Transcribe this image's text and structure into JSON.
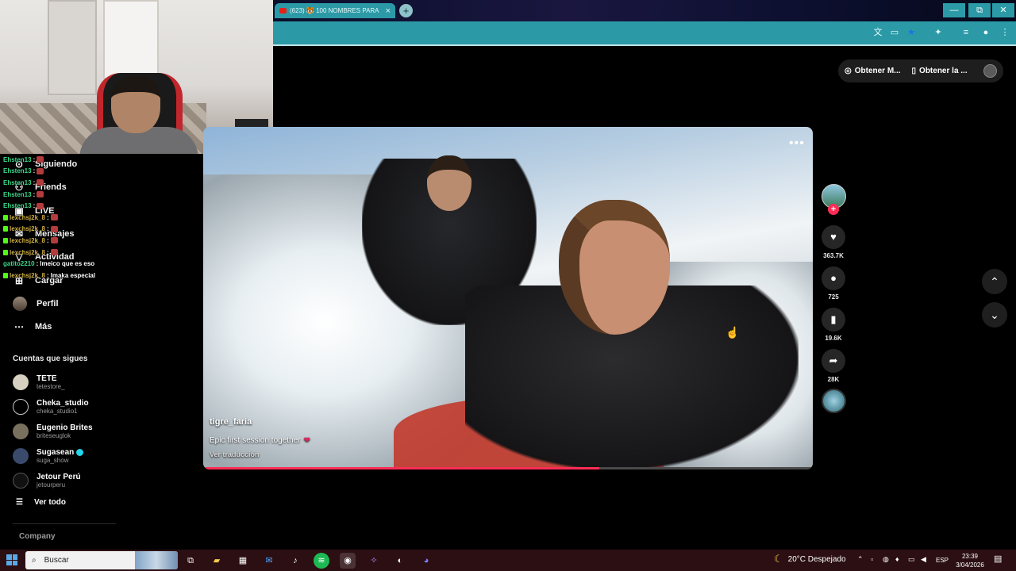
{
  "browser": {
    "tab_title": "(623) 🐯 100 NOMBRES PARA",
    "tab_close": "×",
    "new_tab": "+",
    "window_min": "—",
    "window_max": "⧉",
    "window_close": "✕"
  },
  "tiktok": {
    "nav": [
      {
        "label": "Siguiendo",
        "icon": "following-icon"
      },
      {
        "label": "Friends",
        "icon": "friends-icon"
      },
      {
        "label": "LIVE",
        "icon": "live-icon"
      },
      {
        "label": "Mensajes",
        "icon": "messages-icon"
      },
      {
        "label": "Actividad",
        "icon": "activity-icon"
      },
      {
        "label": "Cargar",
        "icon": "upload-icon"
      },
      {
        "label": "Perfil",
        "icon": "profile-avatar"
      },
      {
        "label": "Más",
        "icon": "more-icon"
      }
    ],
    "following_title": "Cuentas que sigues",
    "accounts": [
      {
        "name": "TETE",
        "handle": "tetestore_",
        "verified": false
      },
      {
        "name": "Cheka_studio",
        "handle": "cheka_studio1",
        "verified": false
      },
      {
        "name": "Eugenio Brites",
        "handle": "briteseuglok",
        "verified": false
      },
      {
        "name": "Sugasean",
        "handle": "suga_show",
        "verified": true
      },
      {
        "name": "Jetour Perú",
        "handle": "jetourperu",
        "verified": false
      }
    ],
    "see_all": "Ver todo",
    "company": "Company",
    "top_pill": {
      "coins": "Obtener M...",
      "app": "Obtener la ..."
    },
    "video": {
      "author": "tigre_faria",
      "caption": "Epic first session together",
      "translate": "Ver traducción",
      "progress": 0.65
    },
    "actions": {
      "likes": "363.7K",
      "comments": "725",
      "saves": "19.6K",
      "shares": "28K"
    }
  },
  "chat": [
    {
      "user": "Ehsten13",
      "msg": "",
      "kick": false
    },
    {
      "user": "Ehsten13",
      "msg": "",
      "kick": false
    },
    {
      "user": "Ehsten13",
      "msg": "",
      "kick": false
    },
    {
      "user": "Ehsten13",
      "msg": "",
      "kick": false
    },
    {
      "user": "Ehsten13",
      "msg": "",
      "kick": false
    },
    {
      "user": "lexchsj2k_8",
      "msg": "",
      "kick": true
    },
    {
      "user": "lexchsj2k_8",
      "msg": "",
      "kick": true
    },
    {
      "user": "lexchsj2k_8",
      "msg": "",
      "kick": true
    },
    {
      "user": "lexchsj2k_8",
      "msg": "",
      "kick": true
    },
    {
      "user": "gatito2210",
      "msg": "lmeico que es eso",
      "kick": false
    },
    {
      "user": "lexchsj2k_8",
      "msg": "lmaka especial",
      "kick": true
    }
  ],
  "taskbar": {
    "search_placeholder": "Buscar",
    "weather": "20°C Despejado",
    "language": "ESP",
    "time": "23:39",
    "date": "3/04/2026"
  },
  "colors": {
    "accent": "#fe2c55",
    "browser": "#2b9aa6",
    "taskbar": "#2b0f12"
  }
}
